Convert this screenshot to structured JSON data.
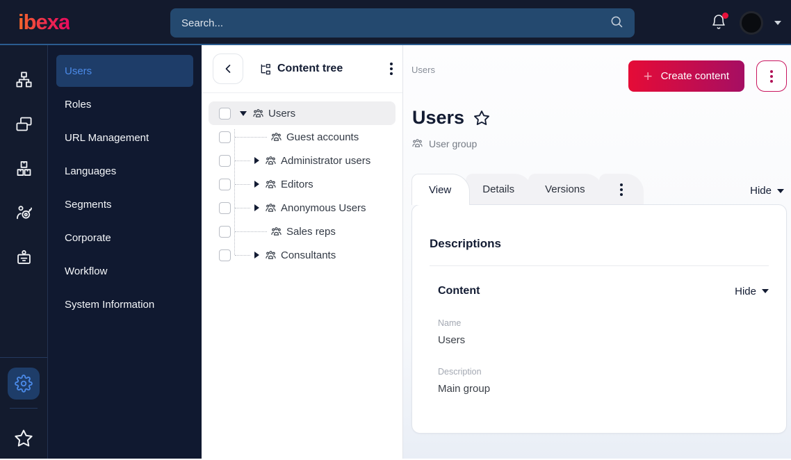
{
  "colors": {
    "topbar_bg": "#131a2d",
    "sidebar_selected_bg": "#1e3d69",
    "accent_blue": "#4b8ae8",
    "brand_gradient_start": "#e50c37",
    "brand_gradient_end": "#a50e63",
    "notification_red": "#e8113c"
  },
  "topbar": {
    "logo_text": "ibexa",
    "search": {
      "placeholder": "Search..."
    },
    "has_notification": true
  },
  "icon_sidebar": {
    "items": [
      {
        "icon": "sitemap-icon"
      },
      {
        "icon": "pages-icon"
      },
      {
        "icon": "products-icon"
      },
      {
        "icon": "audience-target-icon"
      },
      {
        "icon": "badge-icon"
      }
    ],
    "bottom": [
      {
        "icon": "settings-gear-icon",
        "selected": true
      },
      {
        "icon": "bookmark-star-icon"
      }
    ]
  },
  "menu": {
    "items": [
      "Users",
      "Roles",
      "URL Management",
      "Languages",
      "Segments",
      "Corporate",
      "Workflow",
      "System Information"
    ],
    "selected": "Users"
  },
  "content_tree": {
    "title": "Content tree",
    "items": [
      {
        "label": "Users",
        "state": "expanded",
        "selected": true,
        "depth": 0
      },
      {
        "label": "Guest accounts",
        "state": "leaf",
        "depth": 1
      },
      {
        "label": "Administrator users",
        "state": "collapsed",
        "depth": 1
      },
      {
        "label": "Editors",
        "state": "collapsed",
        "depth": 1
      },
      {
        "label": "Anonymous Users",
        "state": "collapsed",
        "depth": 1
      },
      {
        "label": "Sales reps",
        "state": "leaf",
        "depth": 1
      },
      {
        "label": "Consultants",
        "state": "collapsed",
        "depth": 1
      }
    ]
  },
  "main": {
    "breadcrumb": "Users",
    "create_button_label": "Create content",
    "title": "Users",
    "content_type": "User group",
    "tabs": [
      "View",
      "Details",
      "Versions"
    ],
    "active_tab": "View",
    "tabs_hide_label": "Hide",
    "descriptions": {
      "section_title": "Descriptions",
      "content": {
        "title": "Content",
        "hide_label": "Hide",
        "fields": [
          {
            "label": "Name",
            "value": "Users"
          },
          {
            "label": "Description",
            "value": "Main group"
          }
        ]
      }
    }
  }
}
